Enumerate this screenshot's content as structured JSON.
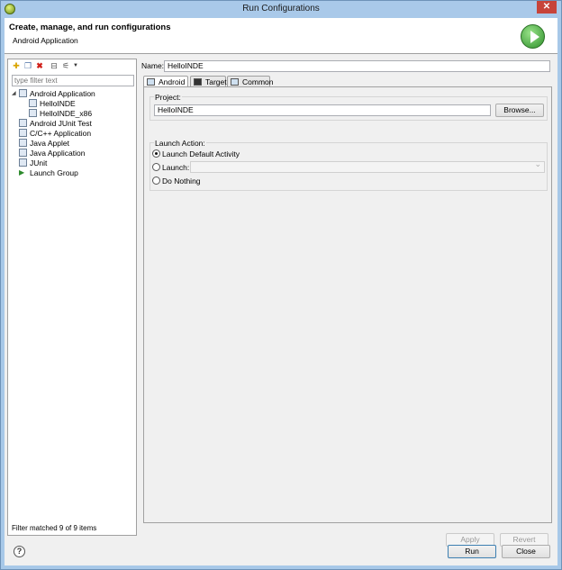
{
  "window": {
    "title": "Run Configurations",
    "close_glyph": "✕"
  },
  "header": {
    "title": "Create, manage, and run configurations",
    "subtitle": "Android Application"
  },
  "left": {
    "filter_placeholder": "type filter text",
    "toolbar_icons": [
      "new-config-icon",
      "duplicate-icon",
      "delete-icon",
      "collapse-all-icon",
      "filter-icon",
      "dropdown-icon"
    ],
    "tree": [
      {
        "label": "Android Application",
        "level": 0,
        "expanded": true,
        "icon": "android-app-icon"
      },
      {
        "label": "HelloINDE",
        "level": 1,
        "icon": "android-config-icon"
      },
      {
        "label": "HelloINDE_x86",
        "level": 1,
        "icon": "android-config-icon"
      },
      {
        "label": "Android JUnit Test",
        "level": 0,
        "icon": "junit-icon"
      },
      {
        "label": "C/C++ Application",
        "level": 0,
        "icon": "cpp-icon"
      },
      {
        "label": "Java Applet",
        "level": 0,
        "icon": "applet-icon"
      },
      {
        "label": "Java Application",
        "level": 0,
        "icon": "java-app-icon"
      },
      {
        "label": "JUnit",
        "level": 0,
        "icon": "junit-icon"
      },
      {
        "label": "Launch Group",
        "level": 0,
        "icon": "launch-group-icon"
      }
    ],
    "filter_status": "Filter matched 9 of 9 items"
  },
  "right": {
    "name_label": "Name:",
    "name_value": "HelloINDE",
    "tabs": [
      "Android",
      "Target",
      "Common"
    ],
    "project_label": "Project:",
    "project_value": "HelloINDE",
    "browse_label": "Browse...",
    "launch_action_label": "Launch Action:",
    "options": [
      {
        "label": "Launch Default Activity",
        "checked": true
      },
      {
        "label": "Launch:",
        "checked": false
      },
      {
        "label": "Do Nothing",
        "checked": false
      }
    ],
    "apply_label": "Apply",
    "revert_label": "Revert"
  },
  "footer": {
    "help_glyph": "?",
    "run_label": "Run",
    "close_label": "Close"
  }
}
